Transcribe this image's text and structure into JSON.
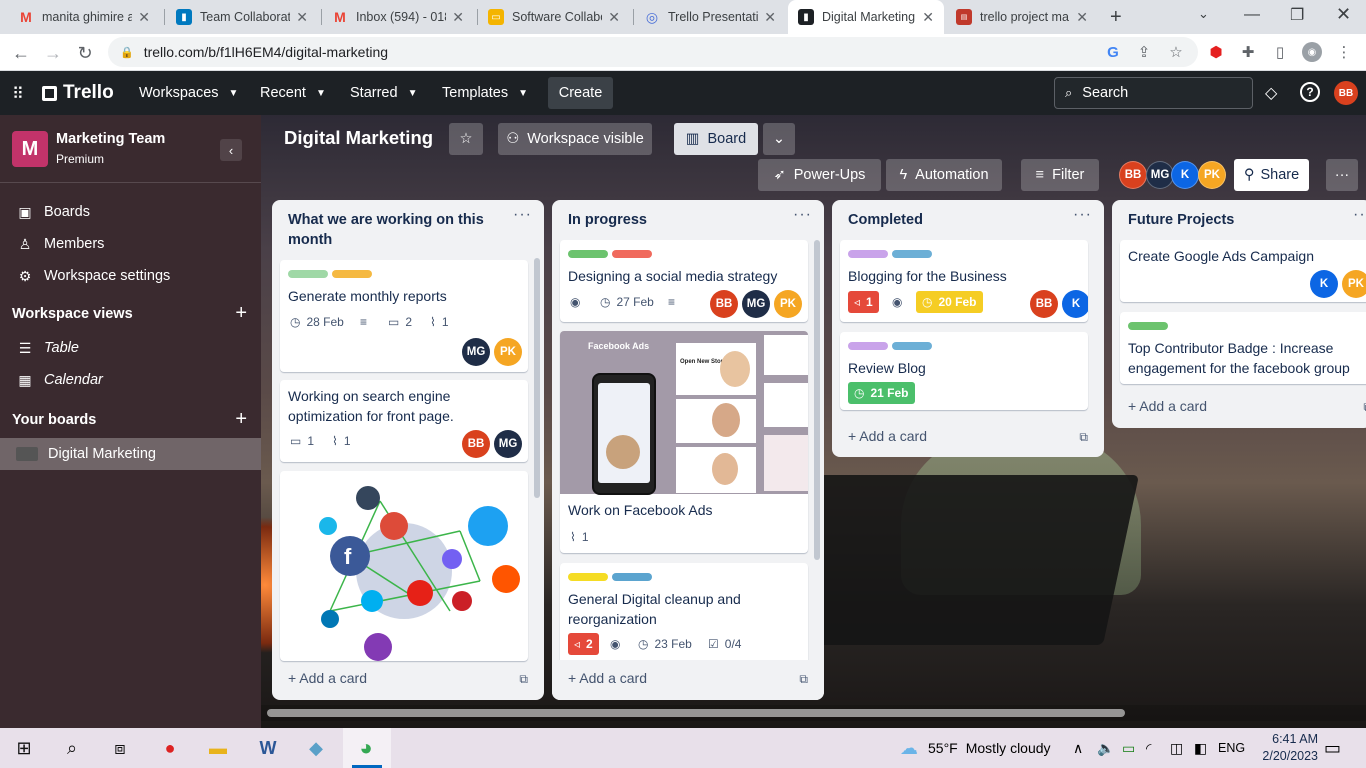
{
  "browser": {
    "tabs": [
      {
        "title": "manita ghimire ai",
        "icon": "gmail-icon",
        "color": "#ea4335"
      },
      {
        "title": "Team Collaboratio",
        "icon": "trello-icon",
        "color": "#0079bf"
      },
      {
        "title": "Inbox (594) - 018",
        "icon": "gmail-icon",
        "color": "#ea4335"
      },
      {
        "title": "Software Collabo",
        "icon": "slides-icon",
        "color": "#f4b400"
      },
      {
        "title": "Trello Presentati",
        "icon": "globe-icon",
        "color": "#4a6fd8"
      },
      {
        "title": "Digital Marketing",
        "icon": "trello-icon",
        "color": "#1d2125"
      },
      {
        "title": "trello project ma",
        "icon": "book-icon",
        "color": "#c0392b"
      }
    ],
    "url": "trello.com/b/f1lH6EM4/digital-marketing"
  },
  "header": {
    "logo": "Trello",
    "nav": [
      "Workspaces",
      "Recent",
      "Starred",
      "Templates"
    ],
    "create": "Create",
    "search_placeholder": "Search",
    "user_initials": "BB"
  },
  "sidebar": {
    "workspace_initial": "M",
    "workspace_name": "Marketing Team",
    "workspace_plan": "Premium",
    "items": [
      "Boards",
      "Members",
      "Workspace settings"
    ],
    "views_header": "Workspace views",
    "views": [
      "Table",
      "Calendar"
    ],
    "boards_header": "Your boards",
    "boards": [
      "Digital Marketing"
    ]
  },
  "board": {
    "title": "Digital Marketing",
    "visibility": "Workspace visible",
    "view": "Board",
    "powerups": "Power-Ups",
    "automation": "Automation",
    "filter": "Filter",
    "share": "Share",
    "members": [
      "BB",
      "MG",
      "K",
      "PK"
    ]
  },
  "lists": [
    {
      "title": "What we are working on this month",
      "cards": [
        {
          "title": "Generate monthly reports",
          "due": "28 Feb",
          "comments": "2",
          "attachments": "1",
          "members": [
            "MG",
            "PK"
          ]
        },
        {
          "title": "Working on search engine optimization for front page.",
          "comments": "1",
          "attachments": "1",
          "members": [
            "BB",
            "MG"
          ]
        }
      ],
      "add": "Add a card"
    },
    {
      "title": "In progress",
      "cards": [
        {
          "title": "Designing a social media strategy",
          "due": "27 Feb",
          "members": [
            "BB",
            "MG",
            "PK"
          ]
        },
        {
          "title": "Work on Facebook Ads",
          "attachments": "1",
          "cover_title": "Facebook Ads",
          "cover_sub": "Open New Store"
        },
        {
          "title": "General Digital cleanup and reorganization",
          "votes": "2",
          "due": "23 Feb",
          "checklist": "0/4"
        }
      ],
      "add": "Add a card"
    },
    {
      "title": "Completed",
      "cards": [
        {
          "title": "Blogging for the Business",
          "votes": "1",
          "due": "20 Feb",
          "members": [
            "BB",
            "K"
          ]
        },
        {
          "title": "Review Blog",
          "due": "21 Feb"
        }
      ],
      "add": "Add a card"
    },
    {
      "title": "Future Projects",
      "cards": [
        {
          "title": "Create Google Ads Campaign",
          "members": [
            "K",
            "PK"
          ]
        },
        {
          "title": "Top Contributor Badge : Increase engagement for the facebook group"
        }
      ],
      "add": "Add a card"
    }
  ],
  "colors": {
    "label_green": "#7ee2b8",
    "label_orange": "#fea362",
    "label_red": "#f87168",
    "label_purple": "#c9a3ea",
    "label_blue": "#6cc3e0",
    "label_yellow": "#f5cd47",
    "avatar_BB": "#d9411e",
    "avatar_MG": "#1f2d47",
    "avatar_K": "#0c66e4",
    "avatar_PK": "#f5a623"
  },
  "taskbar": {
    "weather_temp": "55°F",
    "weather_text": "Mostly cloudy",
    "lang": "ENG",
    "time": "6:41 AM",
    "date": "2/20/2023"
  }
}
